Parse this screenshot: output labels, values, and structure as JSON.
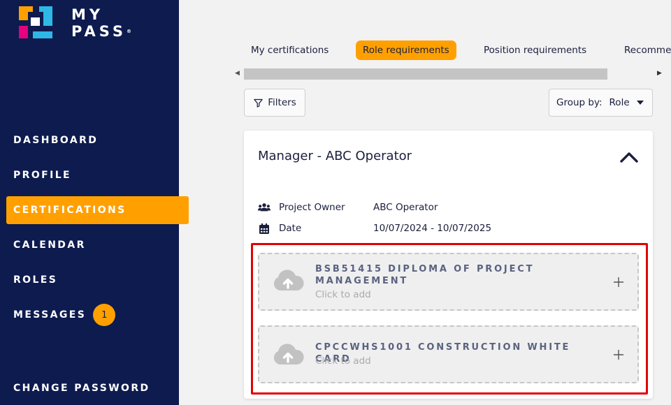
{
  "brand": {
    "line1": "MY",
    "line2": "PASS",
    "reg": "®"
  },
  "nav": [
    {
      "label": "DASHBOARD"
    },
    {
      "label": "PROFILE"
    },
    {
      "label": "CERTIFICATIONS",
      "active": true
    },
    {
      "label": "CALENDAR"
    },
    {
      "label": "ROLES"
    },
    {
      "label": "MESSAGES",
      "badge": "1"
    },
    {
      "label": "CHANGE PASSWORD"
    }
  ],
  "tabs": [
    {
      "label": "My certifications"
    },
    {
      "label": "Role requirements",
      "active": true
    },
    {
      "label": "Position requirements"
    },
    {
      "label": "Recommended"
    }
  ],
  "toolbar": {
    "filters_label": "Filters",
    "group_label": "Group by:",
    "group_value": "Role"
  },
  "card": {
    "title": "Manager - ABC Operator",
    "owner_label": "Project Owner",
    "owner_value": "ABC Operator",
    "date_label": "Date",
    "date_value": "10/07/2024 - 10/07/2025",
    "certs": [
      {
        "title": "BSB51415 DIPLOMA OF PROJECT MANAGEMENT",
        "subtitle": "Click to add"
      },
      {
        "title": "CPCCWHS1001 CONSTRUCTION WHITE CARD",
        "subtitle": "Click to add"
      }
    ]
  },
  "colors": {
    "sidebar": "#0d1b4f",
    "accent": "#ffa000",
    "highlight": "#e30000"
  },
  "icons": [
    "users-icon",
    "calendar-icon",
    "filter-icon",
    "cloud-upload-icon",
    "plus-icon",
    "chevron-up-icon"
  ]
}
